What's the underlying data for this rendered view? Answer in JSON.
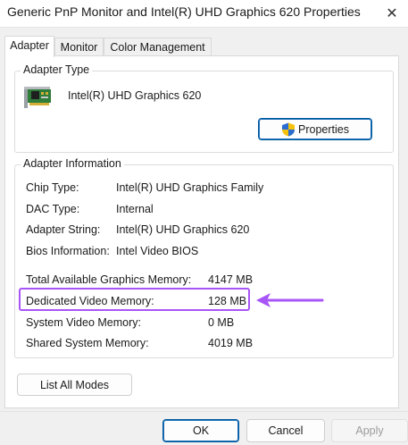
{
  "window": {
    "title": "Generic PnP Monitor and Intel(R) UHD Graphics 620 Properties",
    "close_glyph": "✕"
  },
  "tabs": [
    {
      "label": "Adapter",
      "active": true
    },
    {
      "label": "Monitor",
      "active": false
    },
    {
      "label": "Color Management",
      "active": false
    }
  ],
  "adapter_type": {
    "group_label": "Adapter Type",
    "adapter_name": "Intel(R) UHD Graphics 620",
    "properties_label": "Properties",
    "icon": "graphics-card-icon",
    "shield_icon": "uac-shield-icon"
  },
  "adapter_info": {
    "group_label": "Adapter Information",
    "rows": [
      {
        "label": "Chip Type:",
        "value": "Intel(R) UHD Graphics Family"
      },
      {
        "label": "DAC Type:",
        "value": "Internal"
      },
      {
        "label": "Adapter String:",
        "value": "Intel(R) UHD Graphics 620"
      },
      {
        "label": "Bios Information:",
        "value": "Intel Video BIOS"
      }
    ],
    "memory": [
      {
        "label": "Total Available Graphics Memory:",
        "value": "4147 MB"
      },
      {
        "label": "Dedicated Video Memory:",
        "value": "128 MB"
      },
      {
        "label": "System Video Memory:",
        "value": "0 MB"
      },
      {
        "label": "Shared System Memory:",
        "value": "4019 MB"
      }
    ]
  },
  "list_all_modes_label": "List All Modes",
  "footer": {
    "ok_label": "OK",
    "cancel_label": "Cancel",
    "apply_label": "Apply"
  },
  "annotation": {
    "highlight_color": "#a855f7",
    "arrow_color": "#a855f7"
  }
}
